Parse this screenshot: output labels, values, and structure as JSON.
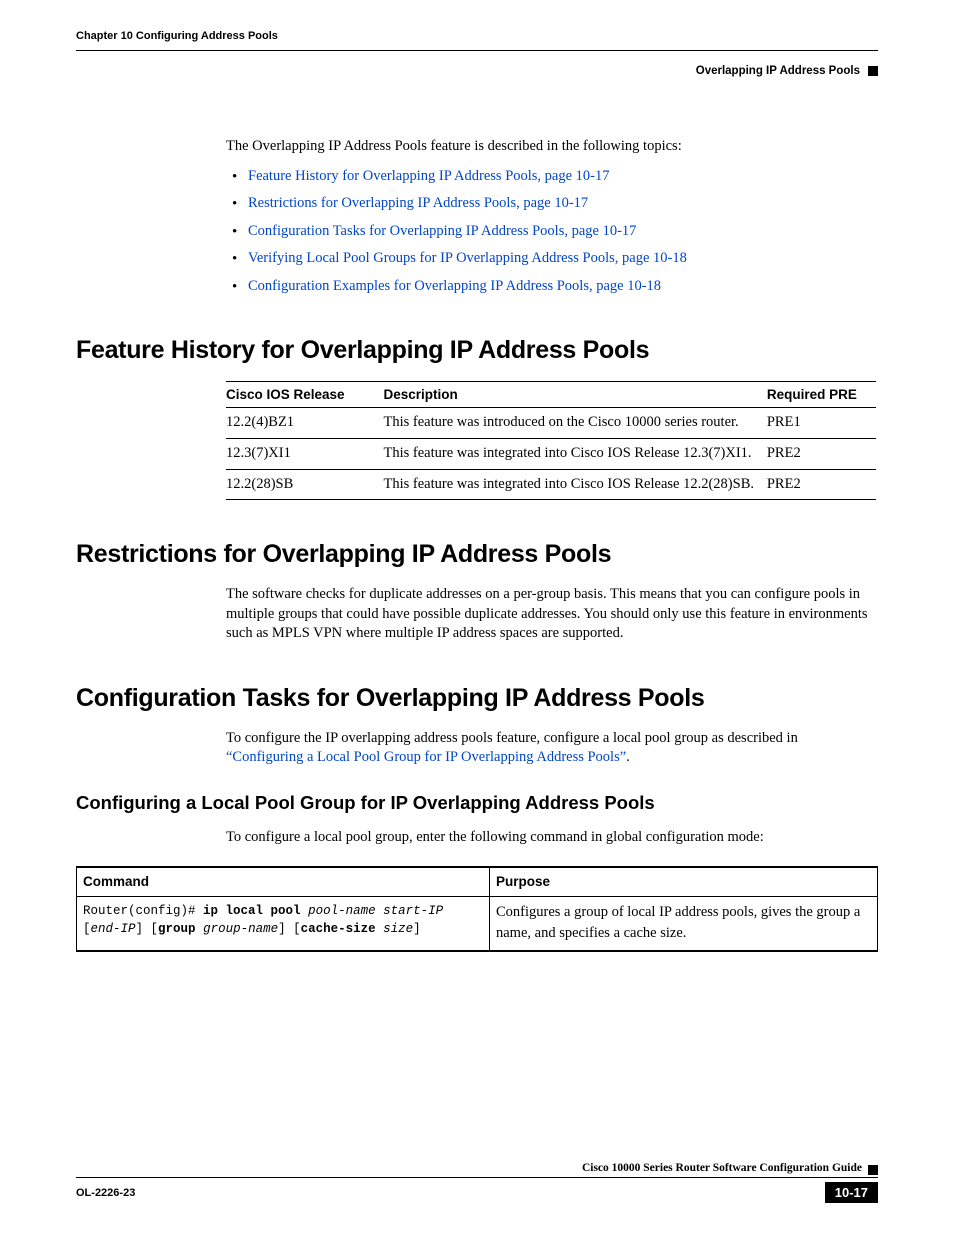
{
  "header": {
    "chapter": "Chapter 10      Configuring Address Pools",
    "section": "Overlapping IP Address Pools"
  },
  "intro": "The Overlapping IP Address Pools feature is described in the following topics:",
  "links": [
    "Feature History for Overlapping IP Address Pools, page 10-17",
    "Restrictions for Overlapping IP Address Pools, page 10-17",
    "Configuration Tasks for Overlapping IP Address Pools, page 10-17",
    "Verifying Local Pool Groups for IP Overlapping Address Pools, page 10-18",
    "Configuration Examples for Overlapping IP Address Pools, page 10-18"
  ],
  "h2_feature": "Feature History for Overlapping IP Address Pools",
  "feature_table": {
    "headers": {
      "release": "Cisco IOS Release",
      "desc": "Description",
      "pre": "Required PRE"
    },
    "rows": [
      {
        "release": "12.2(4)BZ1",
        "desc": "This feature was introduced on the Cisco 10000 series router.",
        "pre": "PRE1"
      },
      {
        "release": "12.3(7)XI1",
        "desc": "This feature was integrated into Cisco IOS Release 12.3(7)XI1.",
        "pre": "PRE2"
      },
      {
        "release": "12.2(28)SB",
        "desc": "This feature was integrated into Cisco IOS Release 12.2(28)SB.",
        "pre": "PRE2"
      }
    ]
  },
  "h2_restrictions": "Restrictions for Overlapping IP Address Pools",
  "restrictions_text": "The software checks for duplicate addresses on a per-group basis. This means that you can configure pools in multiple groups that could have possible duplicate addresses. You should only use this feature in environments such as MPLS VPN where multiple IP address spaces are supported.",
  "h2_config": "Configuration Tasks for Overlapping IP Address Pools",
  "config_intro_pre": "To configure the IP overlapping address pools feature, configure a local pool group as described in ",
  "config_intro_link": "“Configuring a Local Pool Group for IP Overlapping Address Pools”",
  "config_intro_post": ".",
  "h3_local": "Configuring a Local Pool Group for IP Overlapping Address Pools",
  "local_intro": "To configure a local pool group, enter the following command in global configuration mode:",
  "cmd_table": {
    "headers": {
      "command": "Command",
      "purpose": "Purpose"
    },
    "row": {
      "prefix": "Router(config)# ",
      "cmd1": "ip local pool",
      "arg1": " pool-name start-IP",
      "line2_open": "[",
      "arg2": "end-IP",
      "line2_mid1": "] [",
      "cmd2": "group",
      "arg3": " group-name",
      "line2_mid2": "] [",
      "cmd3": "cache-size",
      "arg4": " size",
      "line2_close": "]",
      "purpose": "Configures a group of local IP address pools, gives the group a name, and specifies a cache size."
    }
  },
  "footer": {
    "guide": "Cisco 10000 Series Router Software Configuration Guide",
    "doc": "OL-2226-23",
    "page": "10-17"
  }
}
